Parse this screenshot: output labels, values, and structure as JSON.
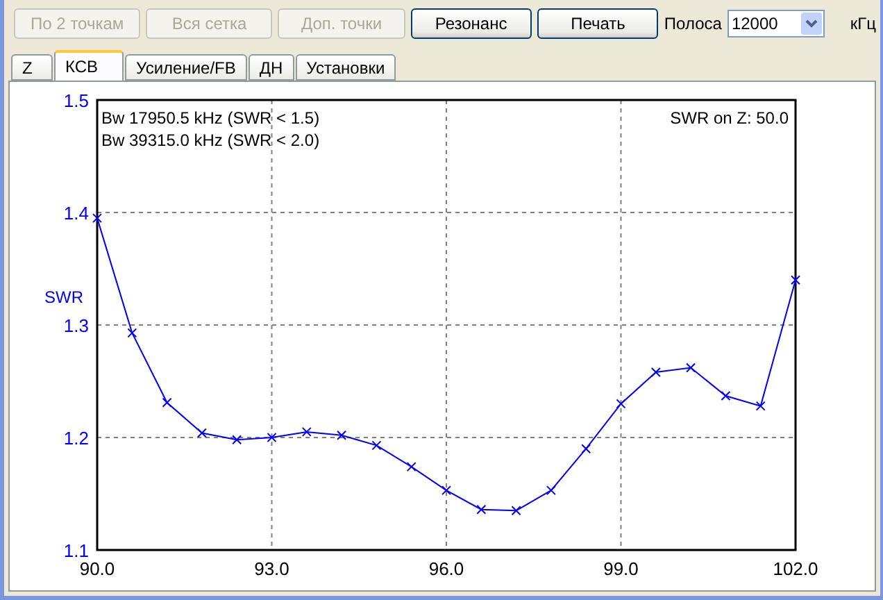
{
  "toolbar": {
    "buttons": [
      {
        "label": "По 2 точкам",
        "disabled": true
      },
      {
        "label": "Вся сетка",
        "disabled": true
      },
      {
        "label": "Доп. точки",
        "disabled": true
      },
      {
        "label": "Резонанс",
        "disabled": false
      },
      {
        "label": "Печать",
        "disabled": false
      }
    ],
    "band": {
      "label": "Полоса",
      "value": "12000",
      "unit": "кГц"
    }
  },
  "tabs": [
    {
      "label": "Z",
      "selected": false
    },
    {
      "label": "КСВ",
      "selected": true
    },
    {
      "label": "Усиление/FB",
      "selected": false
    },
    {
      "label": "ДН",
      "selected": false
    },
    {
      "label": "Установки",
      "selected": false
    }
  ],
  "plot": {
    "bandwidth_lines": [
      "Bw 17950.5 kHz (SWR < 1.5)",
      "Bw 39315.0 kHz (SWR < 2.0)"
    ],
    "reference_note": "SWR on Z: 50.0",
    "chart_data": {
      "type": "line",
      "ylabel": "SWR",
      "x": [
        90,
        90.6,
        91.2,
        91.8,
        92.4,
        93,
        93.6,
        94.2,
        94.8,
        95.4,
        96,
        96.6,
        97.2,
        97.8,
        98.4,
        99,
        99.6,
        100.2,
        100.8,
        101.4,
        102
      ],
      "grid": true,
      "series": [
        {
          "color": "#0000ff",
          "marker": "x",
          "values": [
            1.395,
            1.293,
            1.231,
            1.204,
            1.198,
            1.2,
            1.205,
            1.202,
            1.193,
            1.174,
            1.153,
            1.136,
            1.135,
            1.153,
            1.19,
            1.23,
            1.258,
            1.262,
            1.237,
            1.228,
            1.34
          ]
        }
      ],
      "xlim": [
        90,
        102
      ],
      "ylim": [
        1.1,
        1.5
      ],
      "xticks": [
        {
          "value": 90,
          "label": "90.0"
        },
        {
          "value": 93,
          "label": "93.0"
        },
        {
          "value": 96,
          "label": "96.0"
        },
        {
          "value": 99,
          "label": "99.0"
        },
        {
          "value": 102,
          "label": "102.0"
        }
      ],
      "yticks": [
        {
          "value": 1.1,
          "label": "1.1"
        },
        {
          "value": 1.2,
          "label": "1.2"
        },
        {
          "value": 1.3,
          "label": "1.3"
        },
        {
          "value": 1.4,
          "label": "1.4"
        },
        {
          "value": 1.5,
          "label": "1.5"
        }
      ]
    }
  }
}
